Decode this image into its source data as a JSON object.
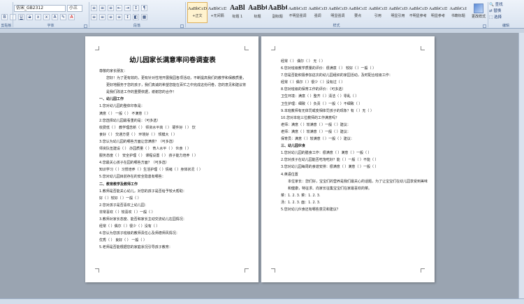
{
  "ribbon": {
    "font_name": "仿宋_GB2312",
    "font_size": "小三",
    "groups": [
      "剪贴板",
      "字体",
      "段落",
      "样式",
      "编辑"
    ],
    "styles": [
      {
        "preview": "AaBbCcDc",
        "name": "+正文",
        "selected": true
      },
      {
        "preview": "AaBbCcDc",
        "name": "+无间隔"
      },
      {
        "preview": "AaBl",
        "name": "标题 1",
        "big": true
      },
      {
        "preview": "AaBbC",
        "name": "标题",
        "big": true
      },
      {
        "preview": "AaBbC",
        "name": "副标题",
        "big": true
      },
      {
        "preview": "AaBbCcDc",
        "name": "不明显强调"
      },
      {
        "preview": "AaBbCcDc",
        "name": "强调"
      },
      {
        "preview": "AaBbCcDc",
        "name": "明显强调"
      },
      {
        "preview": "AaBbCcD",
        "name": "要点"
      },
      {
        "preview": "AaBbCcDc",
        "name": "引用"
      },
      {
        "preview": "AaBbCcDc",
        "name": "明显引用"
      },
      {
        "preview": "AaBbCcDc",
        "name": "不明显参考"
      },
      {
        "preview": "AaBbCcDc",
        "name": "明显参考"
      },
      {
        "preview": "AaBbCcI",
        "name": "书籍标题"
      }
    ],
    "change_styles": "更改样式",
    "editing": [
      "查找",
      "替换",
      "选择"
    ]
  },
  "page_left": {
    "title": "幼儿园家长满意率问卷调查表",
    "lines": [
      {
        "text": "尊敬的家长朋友：",
        "type": "text"
      },
      {
        "text": "您好！为了更有效的，更有针对性地开展我园各项活动，不断提高我们的教学和保教质量，更好地服务于您的孩子，我们真诚的希望您能在百忙之中完成这份问卷，您的意见和建议将是我们改进工作的重要依据，谢谢您的合作！",
        "type": "indent"
      },
      {
        "text": "一、幼儿园工作",
        "type": "heading"
      },
      {
        "text": "1.您对幼儿园的整体印象是：",
        "type": "text"
      },
      {
        "text": "满意（  ）    一般（  ）    不满意（  ）",
        "type": "text"
      },
      {
        "text": "2.您选择幼儿园最看重的是：（可多选）",
        "type": "text"
      },
      {
        "text": "收费低（  ）  教学理念新（  ）  师资水平高（  ）  硬件好（  ）  饮",
        "type": "text"
      },
      {
        "text": "食好（  ）  交通方便（  ）  环境好（  ）  规模大（  ）",
        "type": "text"
      },
      {
        "text": "3.您认为幼儿园的哪些方面让您满意？（可多选）",
        "type": "text"
      },
      {
        "text": "师资队伍建设（  ）  办园质量（  ）  育人水平（  ）  伙食（  ）",
        "type": "text"
      },
      {
        "text": "服务态度（  ）  安全护理（  ）  课程设置（  ）  孩子能力培养（  ）",
        "type": "text"
      },
      {
        "text": "4.您最关心孩子在园的哪些方面？（可多选）",
        "type": "text"
      },
      {
        "text": "知识学习（  ）习惯培养（  ）生活护理（  ）情绪（  ）身体状况（  ）",
        "type": "text"
      },
      {
        "text": "5.您对幼儿园目前存在的安全隐患有哪些：",
        "type": "text"
      },
      {
        "text": "二、教育教学及教师工作",
        "type": "heading"
      },
      {
        "text": "1.教师是否能关心幼儿，对您的孩子是否给予较大帮助：",
        "type": "text"
      },
      {
        "text": "好（  ）较好（  ）一般（  ）",
        "type": "text"
      },
      {
        "text": "2.您对孩子是否喜欢上幼儿园：",
        "type": "text"
      },
      {
        "text": "非常喜欢（  ）较喜欢（  ）一般（  ）",
        "type": "text"
      },
      {
        "text": "3.教师对家长态度、能否和家长主动交流幼儿在园情况：",
        "type": "text"
      },
      {
        "text": "经常（  ）偶尔（  ）很少（  ）没有（  ）",
        "type": "text"
      },
      {
        "text": "4.您认为您孩子班级的教师责任心及师德师风情况：",
        "type": "text"
      },
      {
        "text": "优秀（  ）  良好（  ）  一般（  ）",
        "type": "text"
      },
      {
        "text": "5.老师是否能根据您的家庭状况引导孩子教育：",
        "type": "text"
      }
    ]
  },
  "page_right": {
    "lines": [
      {
        "text": "经常（  ）  偶尔（  ）  无（  ）",
        "type": "text"
      },
      {
        "text": "6.您对班级教学质量的评价：很满意（  ）  较好（  ）一般（  ）",
        "type": "text"
      },
      {
        "text": "7.您是否能积极参加这次的幼儿园组织的家园活动，及时配合班级工作：",
        "type": "text"
      },
      {
        "text": "经常（  ）偶尔（  ）很少（  ）没有过（  ）",
        "type": "text"
      },
      {
        "text": "8.您对班级的保育工作的评价：（可多选）",
        "type": "text"
      },
      {
        "text": "卫生环境：满意（  ）整齐（  ）清洁（  ）零乱（  ）",
        "type": "text"
      },
      {
        "text": "卫生护理：细致（  ）负责（  ）一般（  ）不细致（  ）",
        "type": "text"
      },
      {
        "text": "9.本班教师有无体罚或变相体罚孩子的现象？有（  ）无（  ）",
        "type": "text"
      },
      {
        "text": "10.您对本班三位教师的工作满意吗？",
        "type": "text"
      },
      {
        "text": "老师：满意（  ）较满意（  ）一般（  ）建议：",
        "type": "text"
      },
      {
        "text": "老师：满意（  ）较满意（  ）一般（  ）建议：",
        "type": "text"
      },
      {
        "text": "保育员：满意（  ）较满意（  ）一般（  ）建议：",
        "type": "text"
      },
      {
        "text": "三、幼儿园伙食",
        "type": "heading"
      },
      {
        "text": "1.您对幼儿园的膳食工作：很满意（  ）满意（  ）一般（  ）",
        "type": "text"
      },
      {
        "text": "2.您对孩子在幼儿园能否吃饱吃好？能（  ）一般（  ）不能（  ）",
        "type": "text"
      },
      {
        "text": "3.您对幼儿园每周的食谱安排：很满意（  ）满意（  ）一般（  ）",
        "type": "text"
      },
      {
        "text": "4.英语位置",
        "type": "text"
      },
      {
        "text": "本位家长：您们好，宝宝们的营养是我们最关心的话题，为了让宝宝们在幼儿园享受到美味和健康，特征求、向家长征集宝宝们在家最喜欢的菜。",
        "type": "indent"
      },
      {
        "text": "菜：1.        2.        3.      菜：1.      2.      3.",
        "type": "text"
      },
      {
        "text": "汤：1.        2.        3.      面：1.      2.      3.",
        "type": "text"
      },
      {
        "text": "5.您对幼儿伙食还有哪些意见和建议？",
        "type": "text"
      }
    ]
  }
}
